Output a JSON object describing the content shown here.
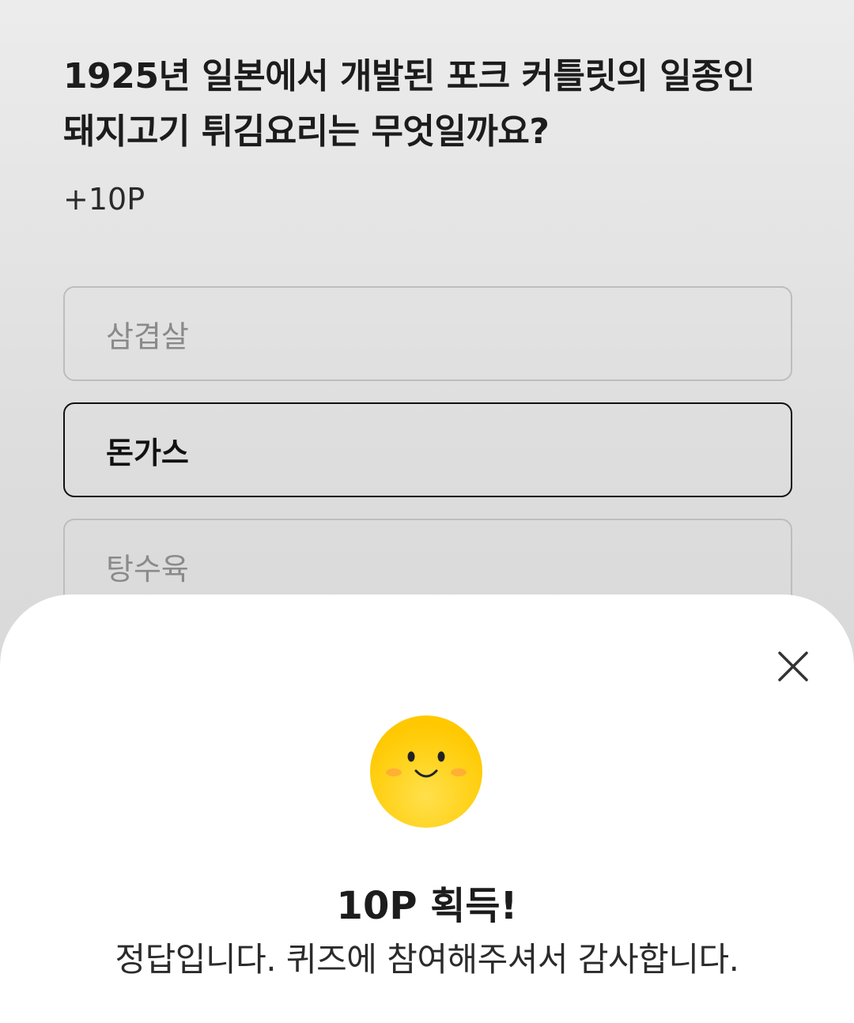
{
  "quiz": {
    "question_line1": "1925년 일본에서 개발된 포크 커틀릿의 일종인",
    "question_line2": "돼지고기 튀김요리는 무엇일까요?",
    "points": "+10P",
    "options": [
      {
        "label": "삼겹살",
        "selected": false
      },
      {
        "label": "돈가스",
        "selected": true
      },
      {
        "label": "탕수육",
        "selected": false
      }
    ]
  },
  "result_sheet": {
    "close_icon": "close-icon",
    "emoji_icon": "smiley-face-icon",
    "title": "10P 획득!",
    "message": "정답입니다. 퀴즈에 참여해주셔서 감사합니다."
  },
  "colors": {
    "accent_yellow": "#FFC800",
    "selected_border": "#111111",
    "unselected_border": "#BDBDBD"
  }
}
